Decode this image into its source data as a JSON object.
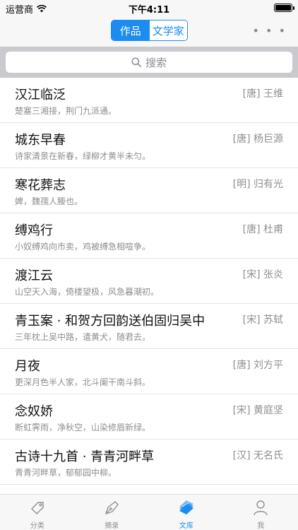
{
  "status_bar": {
    "carrier": "运营商",
    "time": "下午4:11"
  },
  "nav": {
    "segments": [
      {
        "label": "作品",
        "active": true
      },
      {
        "label": "文学家",
        "active": false
      }
    ],
    "more_icon": "ellipsis-icon"
  },
  "search": {
    "placeholder": "搜索"
  },
  "works": [
    {
      "title": "汉江临泛",
      "author": "[唐] 王维",
      "excerpt": "楚塞三湘接，荆门九派通。"
    },
    {
      "title": "城东早春",
      "author": "[唐] 杨巨源",
      "excerpt": "诗家清景在新春，绿柳才黄半未匀。"
    },
    {
      "title": "寒花葬志",
      "author": "[明] 归有光",
      "excerpt": "婢，魏孺人媵也。"
    },
    {
      "title": "缚鸡行",
      "author": "[唐] 杜甫",
      "excerpt": "小奴缚鸡向市卖，鸡被缚急相喧争。"
    },
    {
      "title": "渡江云",
      "author": "[宋] 张炎",
      "excerpt": "山空天入海，倚楼望极，风急暮潮初。"
    },
    {
      "title": "青玉案 · 和贺方回韵送伯固归吴中",
      "author": "[宋] 苏轼",
      "excerpt": "三年枕上吴中路，遣黄犬，随君去。"
    },
    {
      "title": "月夜",
      "author": "[唐] 刘方平",
      "excerpt": "更深月色半人家，北斗阑干南斗斜。"
    },
    {
      "title": "念奴娇",
      "author": "[宋] 黄庭坚",
      "excerpt": "断虹霁雨，净秋空，山染修眉新绿。"
    },
    {
      "title": "古诗十九首 · 青青河畔草",
      "author": "[汉] 无名氏",
      "excerpt": "青青河畔草，郁郁园中柳。"
    }
  ],
  "tabbar": {
    "tabs": [
      {
        "label": "分类",
        "icon": "tag-icon",
        "active": false
      },
      {
        "label": "摘录",
        "icon": "pen-nib-icon",
        "active": false
      },
      {
        "label": "文库",
        "icon": "books-icon",
        "active": true
      },
      {
        "label": "我",
        "icon": "person-icon",
        "active": false
      }
    ]
  },
  "colors": {
    "accent": "#1b8cf0",
    "secondary_text": "#8e8e93",
    "search_bg": "#c9c9ce"
  }
}
